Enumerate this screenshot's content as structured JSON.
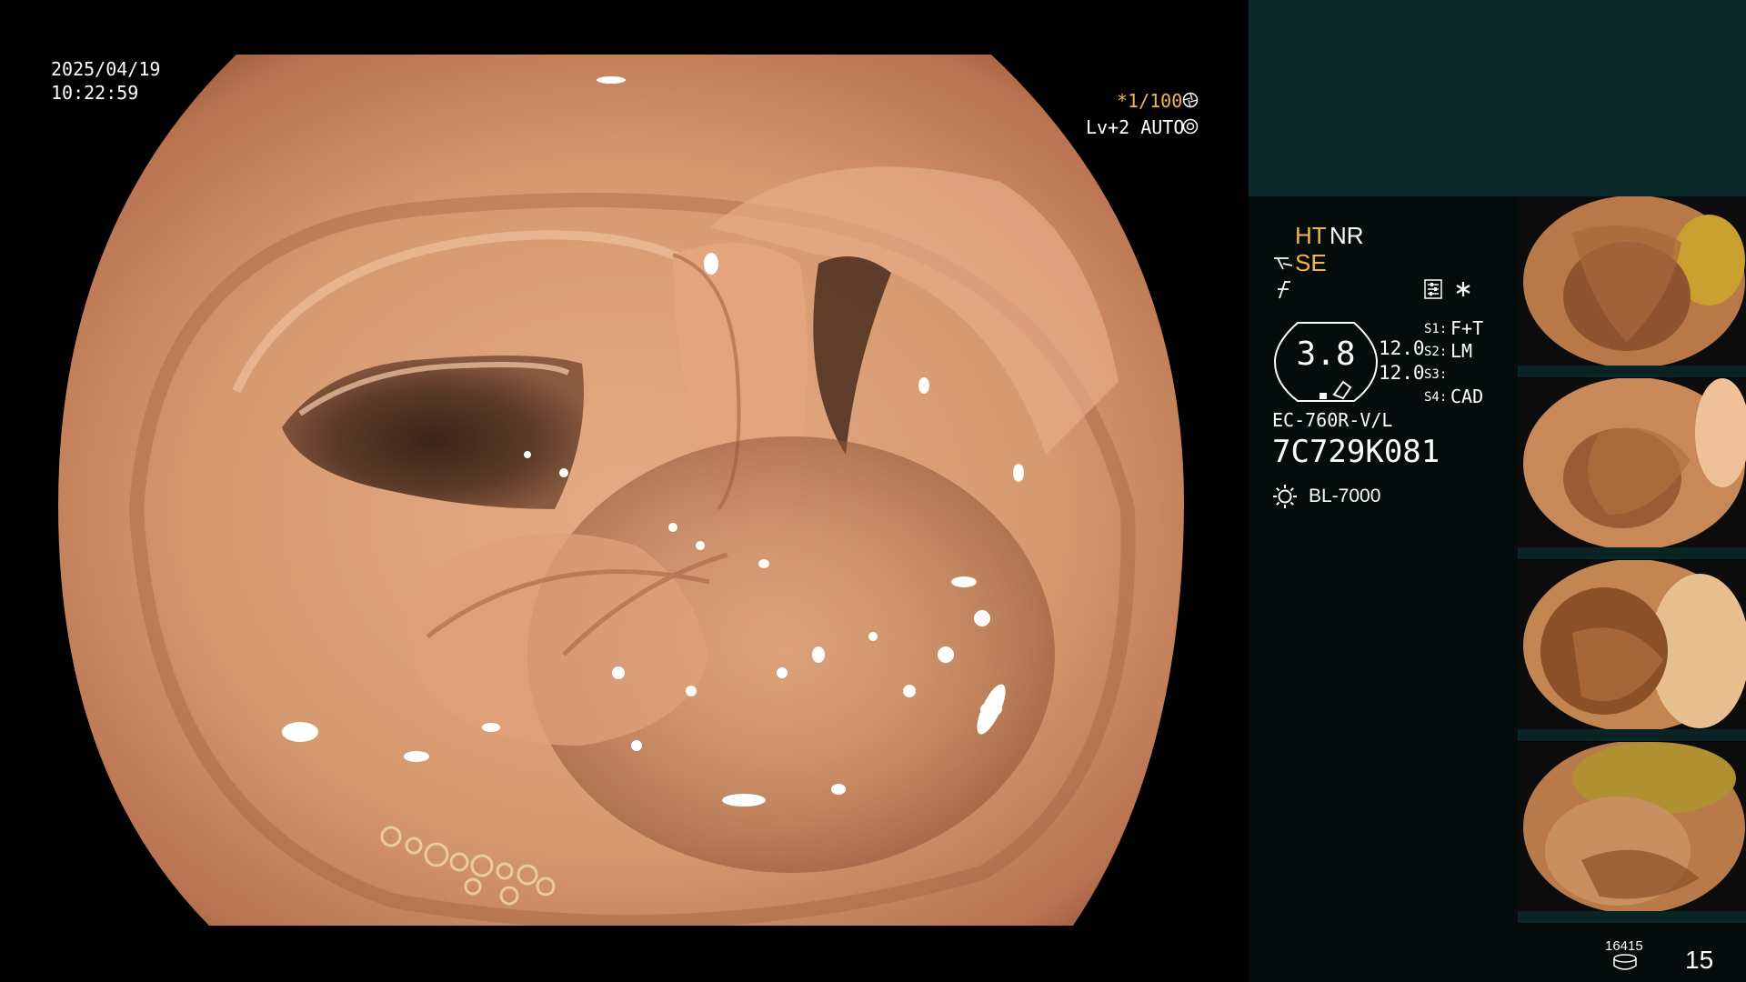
{
  "overlay": {
    "date": "2025/04/19",
    "time": "10:22:59",
    "shutter": "*1/100",
    "shutter_icon": "shutter-speed-icon",
    "level": "Lv+2 AUTO",
    "auto_icon": "auto-exposure-icon"
  },
  "settings": {
    "ht": "HT",
    "nr": "NR",
    "se": "SE",
    "se_icon": "structure-enhancement-icon",
    "f_icon": "filter-icon",
    "settings_icon": "settings-panel-icon",
    "asterisk_icon": "asterisk-icon",
    "accent_color": "#f3b64a"
  },
  "gauge": {
    "value": "3.8",
    "icon": "scope-gauge-icon"
  },
  "readings": {
    "val1": "12.0",
    "val2": "12.0"
  },
  "slots": {
    "s1_label": "S1:",
    "s1_value": "F+T",
    "s2_label": "S2:",
    "s2_value": "LM",
    "s3_label": "S3:",
    "s3_value": "",
    "s4_label": "S4:",
    "s4_value": "CAD"
  },
  "scope": {
    "model": "EC-760R-V/L",
    "serial": "7C729K081",
    "light_source": "BL-7000",
    "light_icon": "light-source-icon"
  },
  "footer": {
    "counter_small": "16415",
    "disk_icon": "storage-disk-icon",
    "counter_large": "15"
  },
  "colors": {
    "panel_bg": "#040c0c",
    "teal_band": "#0b2a2c",
    "tissue": "#d69a70"
  }
}
